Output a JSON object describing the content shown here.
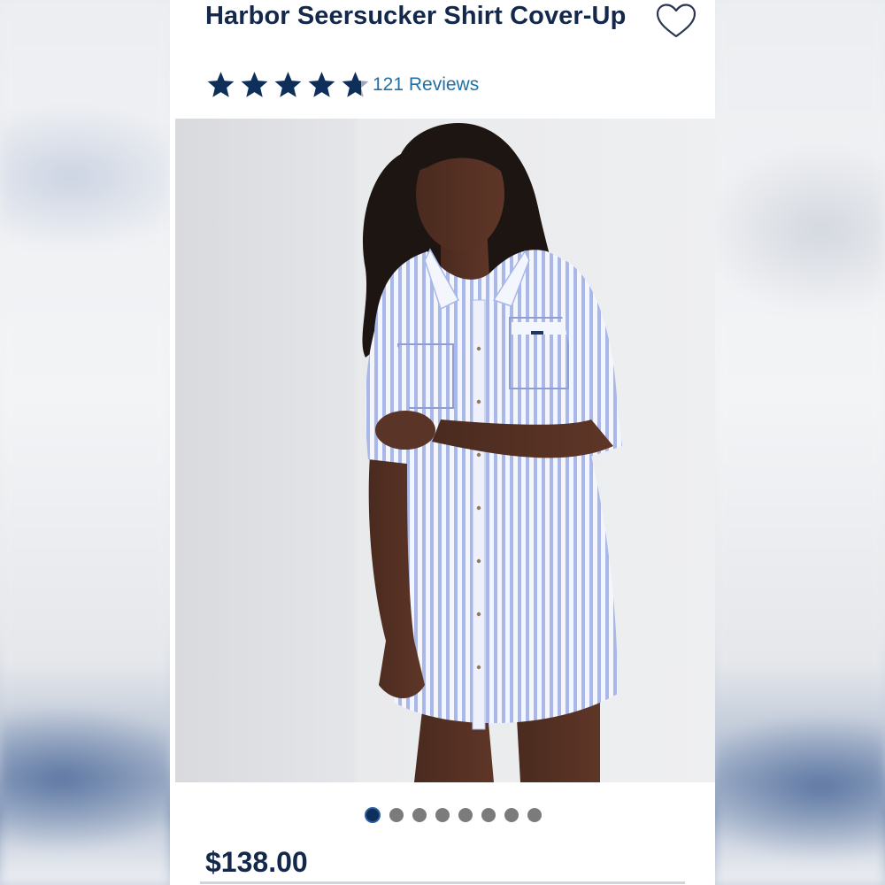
{
  "product": {
    "title": "Harbor Seersucker Shirt Cover-Up",
    "price": "$138.00",
    "image_alt": "Model wearing blue and white striped shirt cover-up dress"
  },
  "rating": {
    "value": 4.7,
    "max": 5,
    "reviews_label": "121 Reviews"
  },
  "carousel": {
    "count": 8,
    "active_index": 0
  },
  "icons": {
    "wishlist": "heart-outline-icon",
    "star": "star-icon"
  },
  "colors": {
    "title": "#14284b",
    "star_fill": "#0f2f5b",
    "link": "#1f6fa8",
    "dot_active": "#0f2f5b",
    "dot_inactive": "#7b7b7b"
  }
}
